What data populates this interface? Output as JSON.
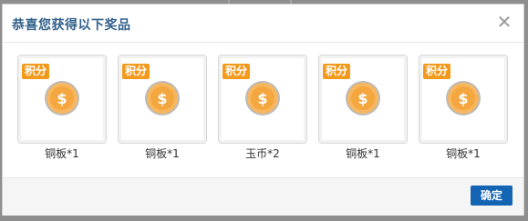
{
  "dialog": {
    "title": "恭喜您获得以下奖品",
    "close_icon": "close-icon",
    "close_symbol": "✕"
  },
  "prizes": [
    {
      "badge": "积分",
      "label": "铜板*1",
      "icon": "coin-icon"
    },
    {
      "badge": "积分",
      "label": "铜板*1",
      "icon": "coin-icon"
    },
    {
      "badge": "积分",
      "label": "玉币*2",
      "icon": "coin-icon"
    },
    {
      "badge": "积分",
      "label": "铜板*1",
      "icon": "coin-icon"
    },
    {
      "badge": "积分",
      "label": "铜板*1",
      "icon": "coin-icon"
    }
  ],
  "footer": {
    "confirm_label": "确定"
  },
  "colors": {
    "accent": "#1464b4",
    "badge": "#f39a1d",
    "title": "#2f5f8a",
    "coin": "#f7b760"
  }
}
